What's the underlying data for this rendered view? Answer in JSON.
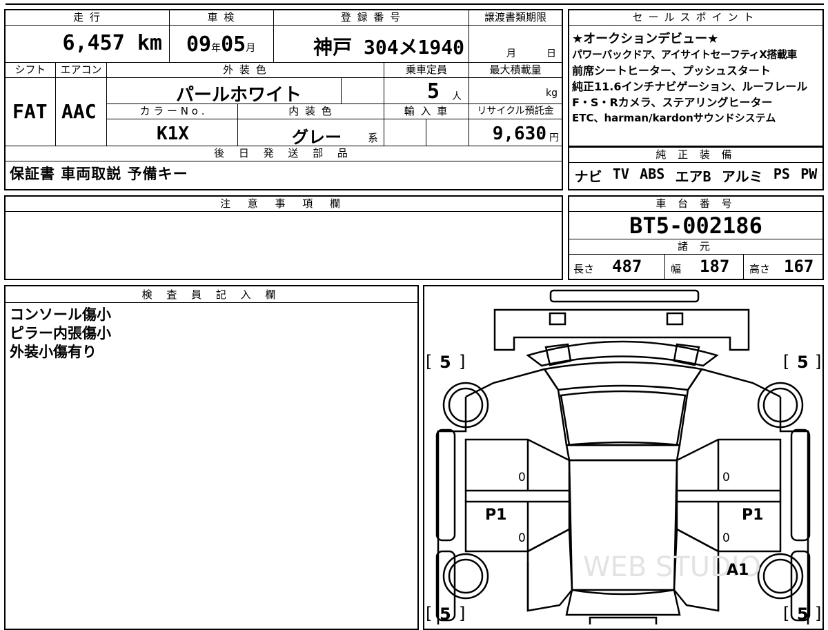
{
  "top": {
    "mileage_label": "走 行",
    "mileage_value": "6,457",
    "mileage_unit": "km",
    "inspection_label": "車 検",
    "inspection_year": "09",
    "inspection_year_unit": "年",
    "inspection_month": "05",
    "inspection_month_unit": "月",
    "registration_label": "登 録 番 号",
    "registration_value": "神戸 304メ1940",
    "transfer_label": "譲渡書類期限",
    "transfer_month_unit": "月",
    "transfer_day_unit": "日",
    "shift_label": "シフト",
    "shift_value": "FAT",
    "aircon_label": "エアコン",
    "aircon_value": "AAC",
    "exterior_label": "外 装 色",
    "exterior_value": "パールホワイト",
    "capacity_label": "乗車定員",
    "capacity_value": "5",
    "capacity_unit": "人",
    "maxload_label": "最大積載量",
    "maxload_unit": "kg",
    "color_no_label": "カ ラ ー N o .",
    "color_no_value": "K1X",
    "interior_label": "内 装 色",
    "interior_value": "グレー",
    "interior_suffix": "系",
    "import_label": "輸 入 車",
    "recycle_label": "リサイクル預託金",
    "recycle_value": "9,630",
    "recycle_unit": "円",
    "later_parts_label": "後 日 発 送 部 品",
    "later_parts_value": "保証書 車両取説 予備キー"
  },
  "sales": {
    "title": "セールスポイント",
    "lines": [
      "★オークションデビュー★",
      "パワーバックドア、アイサイトセーフティX搭載車",
      "前席シートヒーター、プッシュスタート",
      "純正11.6インチナビゲーション、ルーフレール",
      "F・S・Rカメラ、ステアリングヒーター",
      "ETC、harman/kardonサウンドシステム"
    ]
  },
  "equipment": {
    "title": "純 正 装 備",
    "items": [
      "ナビ",
      "TV",
      "ABS",
      "エアB",
      "アルミ",
      "PS",
      "PW"
    ]
  },
  "notes": {
    "title": "注 意 事 項 欄"
  },
  "chassis": {
    "title": "車 台 番 号",
    "number": "BT5-002186",
    "specs_title": "諸 元",
    "length_label": "長さ",
    "length_value": "487",
    "width_label": "幅",
    "width_value": "187",
    "height_label": "高さ",
    "height_value": "167"
  },
  "inspector": {
    "title": "検 査 員 記 入 欄",
    "lines": [
      "コンソール傷小",
      "ピラー内張傷小",
      "外装小傷有り"
    ]
  },
  "diagram": {
    "tire_fl": "5",
    "tire_fr": "5",
    "tire_rl": "5",
    "tire_rr": "5",
    "bracket_open": "[",
    "bracket_close": "]",
    "left_front_door": "0",
    "left_rear_door": "0",
    "right_front_door": "0",
    "right_rear_door": "0",
    "left_pillar": "P1",
    "right_pillar": "P1",
    "right_rear_mark": "A1",
    "watermark": "WEB STUDIO"
  }
}
